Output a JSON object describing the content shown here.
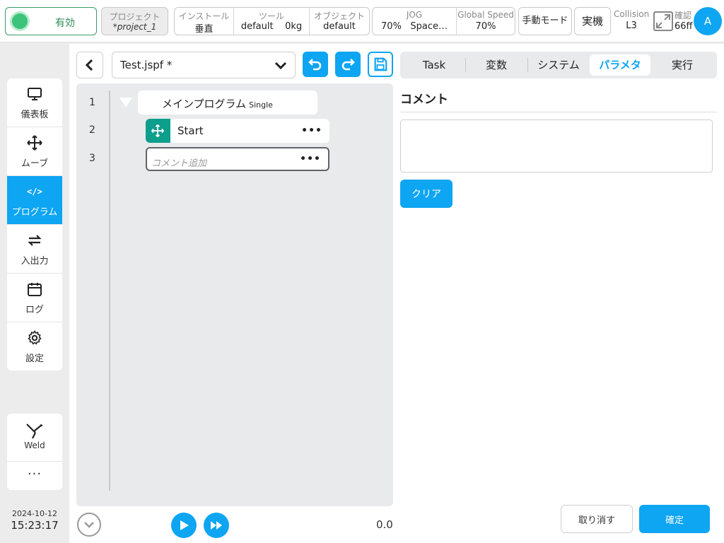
{
  "topbar": {
    "status_label": "有効",
    "project_label": "プロジェクト",
    "project_value": "*project_1",
    "install_label": "インストール",
    "install_value": "垂直",
    "tool_label": "ツール",
    "tool_value": "default",
    "tool_weight": "0kg",
    "object_label": "オブジェクト",
    "object_value": "default",
    "jog_label": "JOG",
    "jog_value": "70%",
    "jog_space": "Space…",
    "speed_label": "Global Speed",
    "speed_value": "70%",
    "mode_label": "手動モード",
    "real_label": "実機",
    "collision_label": "Collision",
    "collision_value": "L3",
    "confirm_label": "確認",
    "confirm_value": "66ff",
    "avatar_letter": "A",
    "status_color": "#3cc47a"
  },
  "nav": {
    "items": [
      {
        "label": "儀表板",
        "icon": "monitor-icon"
      },
      {
        "label": "ムーブ",
        "icon": "move-arrows-icon"
      },
      {
        "label": "プログラム",
        "icon": "code-icon"
      },
      {
        "label": "入出力",
        "icon": "swap-arrows-icon"
      },
      {
        "label": "ログ",
        "icon": "calendar-icon"
      },
      {
        "label": "設定",
        "icon": "gear-icon"
      }
    ],
    "active_index": 2,
    "weld_label": "Weld",
    "more_label": "···"
  },
  "clock": {
    "date": "2024-10-12",
    "time": "15:23:17"
  },
  "editor": {
    "file_name": "Test.jspf *",
    "lines": [
      "1",
      "2",
      "3"
    ],
    "main_program": "メインプログラム",
    "main_mode": "Single",
    "start_label": "Start",
    "comment_placeholder": "コメント追加",
    "dots": "•••",
    "speed_readout": "0.0"
  },
  "panel": {
    "tabs": [
      "Task",
      "変数",
      "システム",
      "パラメタ",
      "実行"
    ],
    "active_tab": 3,
    "section_title": "コメント",
    "comment_value": "",
    "clear_label": "クリア",
    "cancel_label": "取り消す",
    "ok_label": "確定"
  },
  "colors": {
    "accent": "#0ea5f2",
    "teal": "#0e9e8c"
  }
}
